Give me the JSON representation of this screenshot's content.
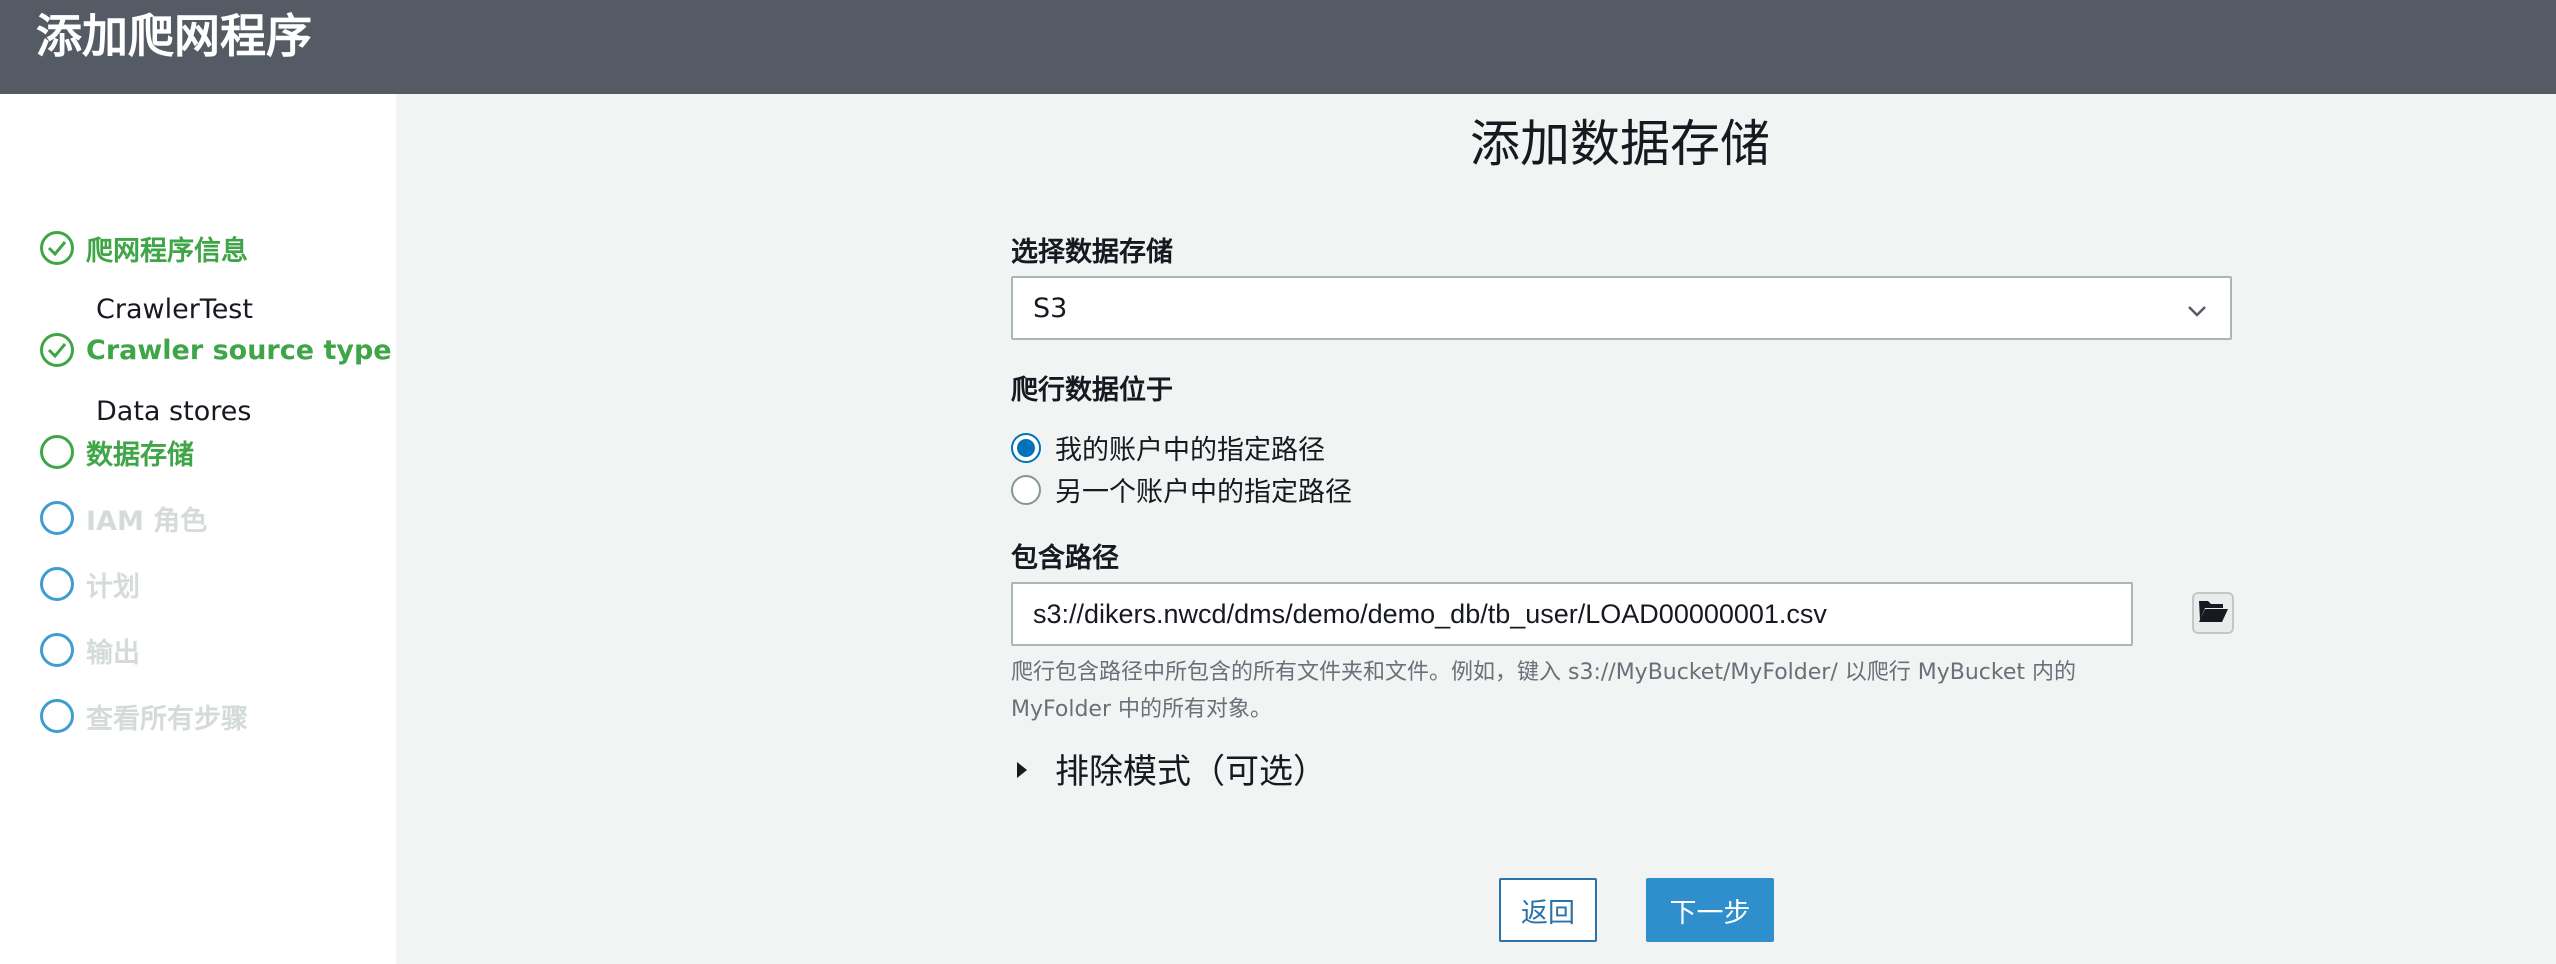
{
  "header": {
    "title": "添加爬网程序"
  },
  "sidebar": {
    "steps": [
      {
        "label": "爬网程序信息",
        "sub": "CrawlerTest",
        "state": "done"
      },
      {
        "label": "Crawler source type",
        "sub": "Data stores",
        "state": "done"
      },
      {
        "label": "数据存储",
        "state": "active"
      },
      {
        "label": "IAM 角色",
        "state": "pending"
      },
      {
        "label": "计划",
        "state": "pending"
      },
      {
        "label": "输出",
        "state": "pending"
      },
      {
        "label": "查看所有步骤",
        "state": "pending"
      }
    ]
  },
  "main": {
    "title": "添加数据存储",
    "select_label": "选择数据存储",
    "select_value": "S3",
    "location_label": "爬行数据位于",
    "radio_options": [
      {
        "label": "我的账户中的指定路径",
        "checked": true
      },
      {
        "label": "另一个账户中的指定路径",
        "checked": false
      }
    ],
    "path_label": "包含路径",
    "path_value": "s3://dikers.nwcd/dms/demo/demo_db/tb_user/LOAD00000001.csv",
    "hint_line1": "爬行包含路径中所包含的所有文件夹和文件。例如，键入 s3://MyBucket/MyFolder/ 以爬行 MyBucket 内的",
    "hint_line2": "MyFolder 中的所有对象。",
    "exclude_label": "排除模式（可选）",
    "back_label": "返回",
    "next_label": "下一步"
  },
  "colors": {
    "header_bg": "#545b64",
    "done_green": "#3fa648",
    "pending_blue": "#3f9ed0",
    "primary_button": "#2e8fcc",
    "radio_selected": "#0073bb"
  },
  "icons": [
    "check-icon",
    "circle-icon",
    "chevron-down-icon",
    "folder-open-icon",
    "caret-right-icon"
  ]
}
